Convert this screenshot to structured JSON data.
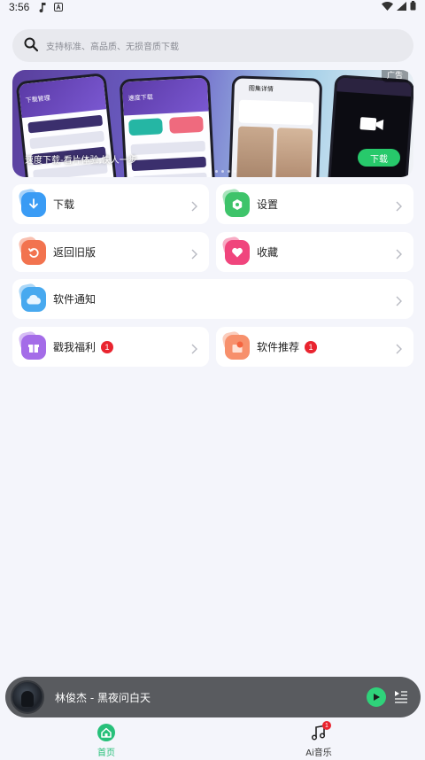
{
  "status_bar": {
    "time": "3:56"
  },
  "search": {
    "placeholder": "支持标准、高品质、无损音质下载"
  },
  "banner": {
    "caption": "速度下载-看片体验,快人一步",
    "ad_tag": "广告",
    "download_label": "下载",
    "phone1_title": "下载管理",
    "phone2_title": "速度下载",
    "phone3_title": "图集详情"
  },
  "menu": {
    "download": "下载",
    "settings": "设置",
    "back_old": "返回旧版",
    "favorites": "收藏",
    "notify": "软件通知",
    "welfare": "戳我福利",
    "welfare_badge": "1",
    "recommend": "软件推荐",
    "recommend_badge": "1"
  },
  "player": {
    "song": "林俊杰 - 黑夜问白天"
  },
  "tabs": {
    "home": "首页",
    "ai_music": "Ai音乐",
    "ai_badge": "1"
  },
  "colors": {
    "accent_green": "#27c07a",
    "badge_red": "#e9242f"
  }
}
